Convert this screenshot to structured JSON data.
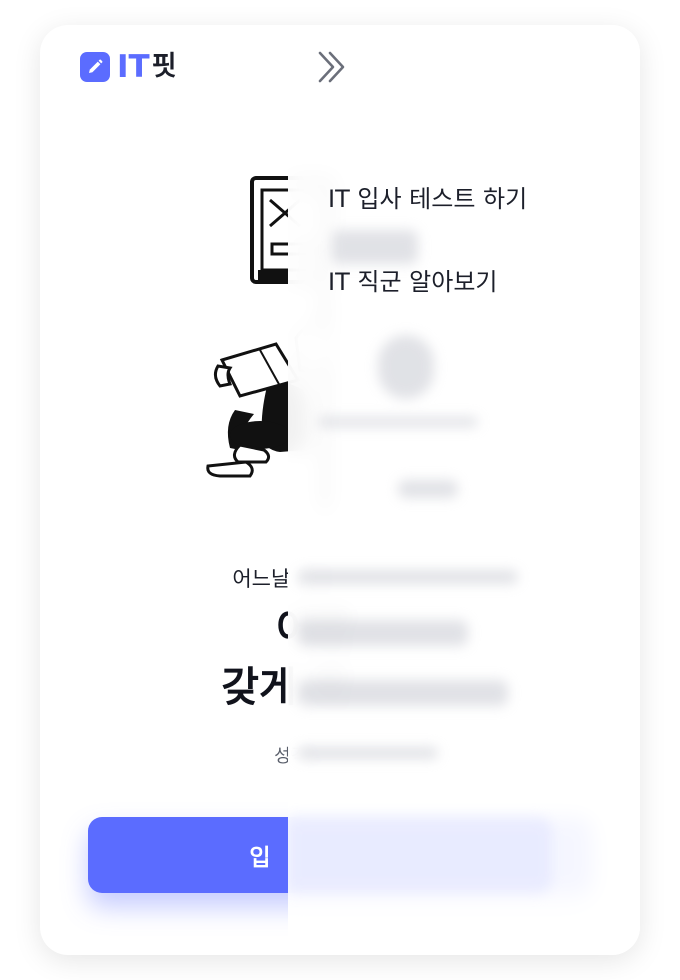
{
  "header": {
    "logo_abbr": "IT",
    "logo_suffix": "핏",
    "logo_icon": "pencil-icon",
    "menu_icon": "menu-icon"
  },
  "hero": {
    "subtitle": "어느날 갑자",
    "title_line1": "어떤",
    "title_line2": "갖게 되",
    "description": "성격별",
    "cta_label": "입",
    "illustration": "person-reading-illustration"
  },
  "drawer": {
    "collapse_icon": "double-chevron-right-icon",
    "items": [
      {
        "label": "IT 입사 테스트 하기"
      },
      {
        "label": "IT 직군 알아보기"
      }
    ]
  },
  "colors": {
    "brand": "#5b6cff",
    "text": "#1c1f2a",
    "background": "#ffffff"
  }
}
